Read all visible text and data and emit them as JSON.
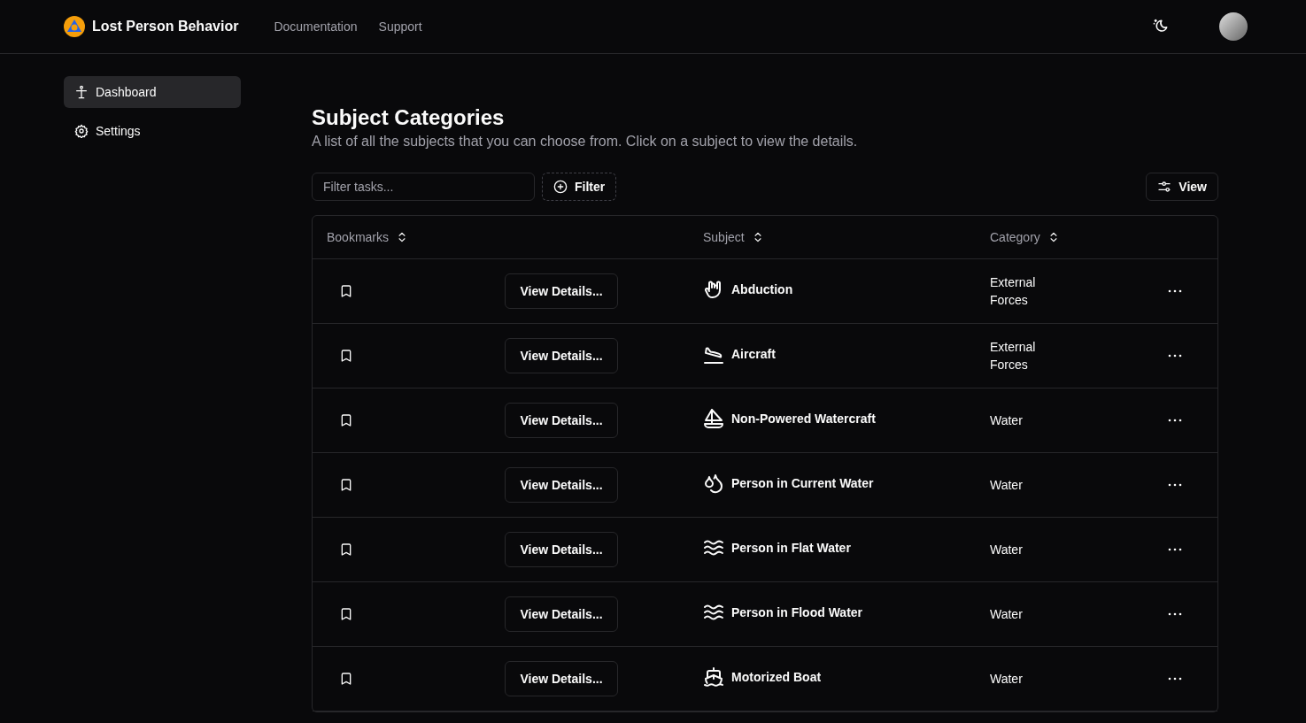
{
  "header": {
    "brand": "Lost Person Behavior",
    "nav": [
      {
        "label": "Documentation"
      },
      {
        "label": "Support"
      }
    ]
  },
  "sidebar": {
    "items": [
      {
        "label": "Dashboard",
        "kind": "person",
        "selected": true
      },
      {
        "label": "Settings",
        "kind": "gear",
        "selected": false
      }
    ]
  },
  "page": {
    "title": "Subject Categories",
    "description": "A list of all the subjects that you can choose from. Click on a subject to view the details."
  },
  "toolbar": {
    "search": {
      "placeholder": "Filter tasks..."
    },
    "filter_button": "Filter",
    "view_button": "View"
  },
  "table": {
    "columns": [
      "Bookmarks",
      "Subject",
      "Category"
    ],
    "rows": [
      {
        "bookmarked": false,
        "button": "View Details...",
        "kind": "hand",
        "subject": "Abduction",
        "category": "External Forces"
      },
      {
        "bookmarked": false,
        "button": "View Details...",
        "kind": "plane",
        "subject": "Aircraft",
        "category": "External Forces"
      },
      {
        "bookmarked": false,
        "button": "View Details...",
        "kind": "sailboat",
        "subject": "Non-Powered Watercraft",
        "category": "Water"
      },
      {
        "bookmarked": false,
        "button": "View Details...",
        "kind": "droplets",
        "subject": "Person in Current Water",
        "category": "Water"
      },
      {
        "bookmarked": false,
        "button": "View Details...",
        "kind": "waves",
        "subject": "Person in Flat Water",
        "category": "Water"
      },
      {
        "bookmarked": false,
        "button": "View Details...",
        "kind": "waves",
        "subject": "Person in Flood Water",
        "category": "Water"
      },
      {
        "bookmarked": false,
        "button": "View Details...",
        "kind": "ship",
        "subject": "Motorized Boat",
        "category": "Water"
      }
    ]
  }
}
